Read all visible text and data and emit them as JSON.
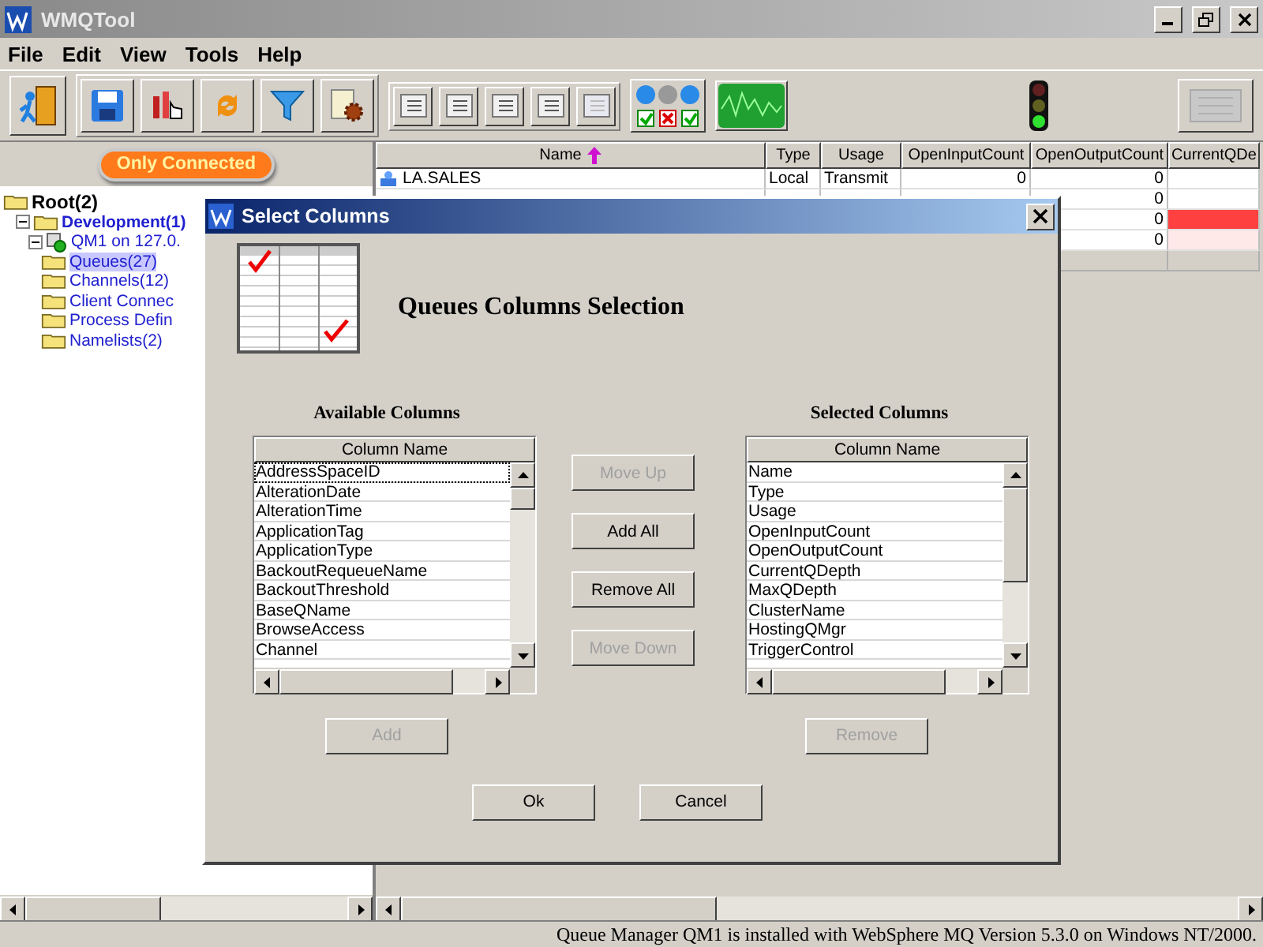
{
  "window": {
    "title": "WMQTool"
  },
  "menu": [
    "File",
    "Edit",
    "View",
    "Tools",
    "Help"
  ],
  "filter_button": {
    "label": "Only Connected"
  },
  "tree": {
    "label": "Root(2)",
    "selected": false,
    "children": [
      {
        "label": "Development(1)",
        "expanded": true,
        "selected": false,
        "children": [
          {
            "label": "QM1  on 127.0.",
            "expanded": true,
            "selected": false,
            "children": [
              {
                "label": "Queues(27)",
                "selected": true
              },
              {
                "label": "Channels(12)",
                "selected": false
              },
              {
                "label": "Client Connec",
                "selected": false
              },
              {
                "label": "Process Defin",
                "selected": false
              },
              {
                "label": "Namelists(2)",
                "selected": false
              }
            ]
          }
        ]
      }
    ]
  },
  "table": {
    "columns": [
      {
        "label": "Name",
        "sorted": true
      },
      {
        "label": "Type",
        "sorted": false
      },
      {
        "label": "Usage",
        "sorted": false
      },
      {
        "label": "OpenInputCount",
        "sorted": false
      },
      {
        "label": "OpenOutputCount",
        "sorted": false
      },
      {
        "label": "CurrentQDe",
        "sorted": false
      }
    ],
    "rows": [
      {
        "name": "LA.SALES",
        "type": "Local",
        "usage": "Transmit",
        "open_input_count": "0",
        "open_output_count": "0",
        "color": "#ffffff"
      },
      {
        "open_output_count": "0",
        "color": "#ffffff"
      },
      {
        "open_output_count": "0",
        "color": "#ff4040"
      },
      {
        "open_output_count": "0",
        "color": "#ffe8e8"
      }
    ]
  },
  "dialog": {
    "title": "Select Columns",
    "heading": "Queues Columns Selection",
    "available": {
      "label": "Available Columns",
      "header": "Column Name",
      "items": [
        "AddressSpaceID",
        "AlterationDate",
        "AlterationTime",
        "ApplicationTag",
        "ApplicationType",
        "BackoutRequeueName",
        "BackoutThreshold",
        "BaseQName",
        "BrowseAccess",
        "Channel"
      ]
    },
    "selected": {
      "label": "Selected Columns",
      "header": "Column Name",
      "items": [
        "Name",
        "Type",
        "Usage",
        "OpenInputCount",
        "OpenOutputCount",
        "CurrentQDepth",
        "MaxQDepth",
        "ClusterName",
        "HostingQMgr",
        "TriggerControl"
      ]
    },
    "middle_buttons": [
      {
        "label": "Move Up",
        "disabled": true
      },
      {
        "label": "Add All",
        "disabled": false
      },
      {
        "label": "Remove All",
        "disabled": false
      },
      {
        "label": "Move Down",
        "disabled": true
      }
    ],
    "add_button": {
      "label": "Add",
      "disabled": true
    },
    "remove_button": {
      "label": "Remove",
      "disabled": true
    },
    "footer_buttons": [
      {
        "label": "Ok",
        "disabled": false
      },
      {
        "label": "Cancel",
        "disabled": false
      }
    ]
  },
  "status_bar": "Queue Manager QM1  is installed with WebSphere MQ Version 5.3.0 on Windows NT/2000."
}
